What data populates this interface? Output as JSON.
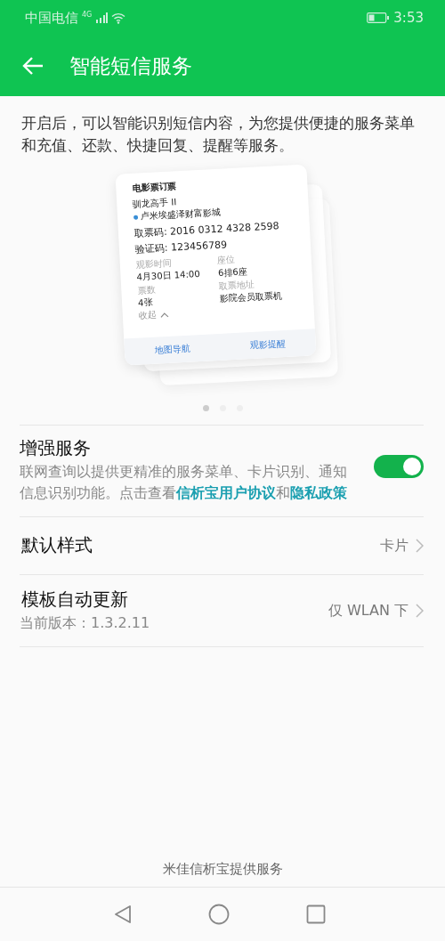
{
  "status_bar": {
    "carrier": "中国电信",
    "network": "4G",
    "time": "3:53"
  },
  "header": {
    "title": "智能短信服务"
  },
  "intro": "开启后，可以智能识别短信内容，为您提供便捷的服务菜单和充值、还款、快捷回复、提醒等服务。",
  "preview_card": {
    "title": "电影票订票",
    "movie": "驯龙高手 II",
    "cinema": "卢米埃盛泽财富影城",
    "ticket_code": "取票码: 2016 0312 4328 2598",
    "verify_code": "验证码: 123456789",
    "fields": [
      {
        "label": "观影时间",
        "value": "4月30日 14:00"
      },
      {
        "label": "座位",
        "value": "6排6座"
      },
      {
        "label": "票数",
        "value": "4张"
      },
      {
        "label": "取票地址",
        "value": "影院会员取票机"
      }
    ],
    "collapse": "收起",
    "actions": [
      "地图导航",
      "观影提醒"
    ]
  },
  "carousel_dots": [
    {
      "selected": true
    },
    {
      "selected": false
    },
    {
      "selected": false
    }
  ],
  "settings": [
    {
      "kind": "toggle",
      "title": "增强服务",
      "description": "联网查询以提供更精准的服务菜单、卡片识别、通知信息识别功能。点击查看",
      "links": [
        "信析宝用户协议",
        "隐私政策"
      ],
      "joiner": "和",
      "on": true
    },
    {
      "kind": "link",
      "title": "默认样式",
      "value": "卡片"
    },
    {
      "kind": "link",
      "title": "模板自动更新",
      "subtitle": "当前版本：1.3.2.11",
      "value": "仅 WLAN 下"
    }
  ],
  "footer": "米佳信析宝提供服务"
}
